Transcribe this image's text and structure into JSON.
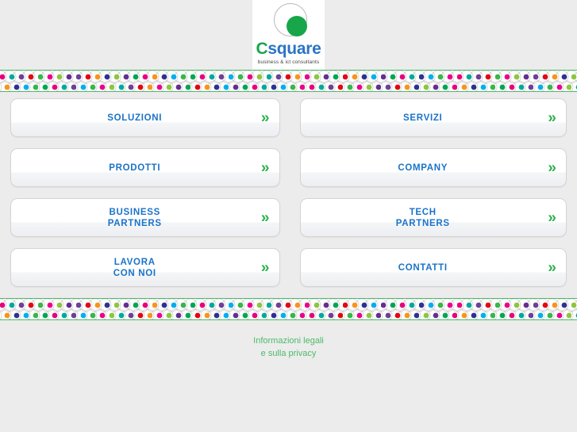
{
  "page": {
    "background_color": "#ececec",
    "accent_blue": "#1a73c8",
    "accent_green": "#4cba6a",
    "logo_green": "#17a64a",
    "logo_blue": "#2a74c4"
  },
  "header": {
    "logo": {
      "word_first": "C",
      "word_rest": "square",
      "tagline": "business & ict consultants"
    }
  },
  "decor": {
    "dot_colors": [
      "#e8007d",
      "#00a99d",
      "#6d3f97",
      "#e30613",
      "#f7941e",
      "#2e3192",
      "#00aeef",
      "#39b54a",
      "#ec008c",
      "#8dc63f",
      "#662d91",
      "#00a651"
    ]
  },
  "menu": {
    "items": [
      {
        "label": "SOLUZIONI",
        "arrow": "»",
        "column": "left"
      },
      {
        "label": "SERVIZI",
        "arrow": "»",
        "column": "right"
      },
      {
        "label": "PRODOTTI",
        "arrow": "»",
        "column": "left"
      },
      {
        "label": "COMPANY",
        "arrow": "»",
        "column": "right"
      },
      {
        "label": "BUSINESS\nPARTNERS",
        "arrow": "»",
        "column": "left"
      },
      {
        "label": "TECH\nPARTNERS",
        "arrow": "»",
        "column": "right"
      },
      {
        "label": "LAVORA\nCON NOI",
        "arrow": "»",
        "column": "left"
      },
      {
        "label": "CONTATTI",
        "arrow": "»",
        "column": "right"
      }
    ]
  },
  "footer": {
    "legal_link": "Informazioni legali\ne sulla privacy"
  }
}
